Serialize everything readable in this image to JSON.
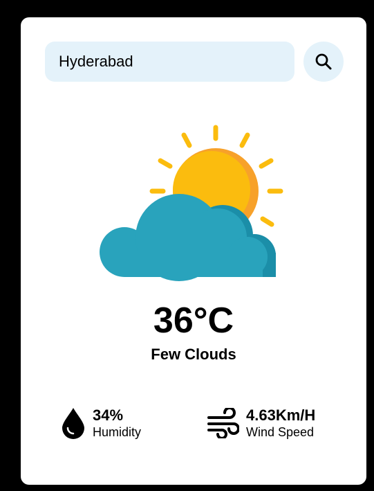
{
  "search": {
    "value": "Hyderabad",
    "button_icon": "search-icon"
  },
  "weather": {
    "icon": "partly-cloudy-icon",
    "temperature": "36°C",
    "condition": "Few Clouds"
  },
  "stats": {
    "humidity": {
      "icon": "humidity-drop-icon",
      "value": "34%",
      "label": "Humidity"
    },
    "wind": {
      "icon": "wind-icon",
      "value": "4.63Km/H",
      "label": "Wind Speed"
    }
  },
  "colors": {
    "page_background": "#000000",
    "card_background": "#ffffff",
    "search_background": "#e4f2fa",
    "sun": "#fbbc0e",
    "sun_shade": "#f7a12a",
    "cloud": "#29a3bc",
    "cloud_shade": "#1b8ea8",
    "text": "#000000"
  }
}
